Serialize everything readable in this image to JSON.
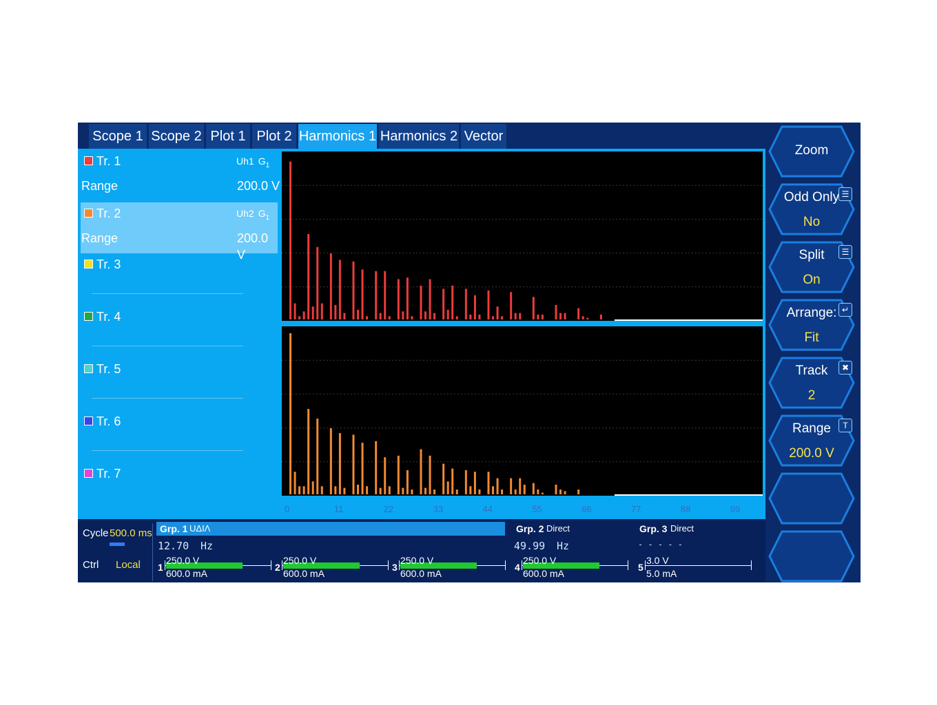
{
  "tabs": [
    "Scope 1",
    "Scope 2",
    "Plot 1",
    "Plot 2",
    "Harmonics 1",
    "Harmonics 2",
    "Vector"
  ],
  "active_tab": "Harmonics 1",
  "tracks": [
    {
      "label": "Tr. 1",
      "color": "#ee3b3b",
      "signal": "Uh1",
      "group": "G",
      "group_sub": "1",
      "range_label": "Range",
      "range_value": "200.0 V"
    },
    {
      "label": "Tr. 2",
      "color": "#f28a33",
      "signal": "Uh2",
      "group": "G",
      "group_sub": "1",
      "range_label": "Range",
      "range_value": "200.0 V"
    },
    {
      "label": "Tr. 3",
      "color": "#f3e21b"
    },
    {
      "label": "Tr. 4",
      "color": "#24a745"
    },
    {
      "label": "Tr. 5",
      "color": "#45d6d2"
    },
    {
      "label": "Tr. 6",
      "color": "#3a45e6"
    },
    {
      "label": "Tr. 7",
      "color": "#e046d6"
    }
  ],
  "softkeys": [
    {
      "label": "Zoom",
      "value": "",
      "icon": ""
    },
    {
      "label": "Odd Only",
      "value": "No",
      "icon": "list-icon"
    },
    {
      "label": "Split",
      "value": "On",
      "icon": "list-icon"
    },
    {
      "label": "Arrange:",
      "value": "Fit",
      "icon": "enter-icon"
    },
    {
      "label": "Track",
      "value": "2",
      "icon": "tools-icon"
    },
    {
      "label": "Range",
      "value": "200.0 V",
      "icon": "range-icon"
    },
    {
      "label": "",
      "value": "",
      "icon": ""
    },
    {
      "label": "",
      "value": "",
      "icon": ""
    }
  ],
  "status": {
    "cycle_label": "Cycle",
    "cycle_value": "500.0 ms",
    "ctrl_label": "Ctrl",
    "ctrl_value": "Local",
    "groups": [
      {
        "name": "Grp. 1",
        "mode": "UΔIΛ",
        "value": "12.70",
        "unit": "Hz"
      },
      {
        "name": "Grp. 2",
        "mode": "Direct",
        "value": "49.99",
        "unit": "Hz"
      },
      {
        "name": "Grp. 3",
        "mode": "Direct",
        "value": "- - - - -",
        "unit": ""
      }
    ],
    "channels": [
      {
        "num": "1",
        "voltage": "250.0 V",
        "current": "600.0 mA",
        "level": 0.85
      },
      {
        "num": "2",
        "voltage": "250.0 V",
        "current": "600.0 mA",
        "level": 0.85
      },
      {
        "num": "3",
        "voltage": "250.0 V",
        "current": "600.0 mA",
        "level": 0.85
      },
      {
        "num": "4",
        "voltage": "250.0 V",
        "current": "600.0 mA",
        "level": 0.85
      },
      {
        "num": "5",
        "voltage": "3.0 V",
        "current": "5.0 mA",
        "level": 0.0
      }
    ]
  },
  "chart_data": [
    {
      "type": "bar",
      "series": [
        {
          "name": "Tr. 1",
          "color": "#ee3b3b"
        }
      ],
      "x_ticks": [],
      "x_range": [
        0,
        105
      ],
      "y_range": [
        0,
        1
      ],
      "grid": true,
      "bars": [
        [
          1,
          0.98
        ],
        [
          2,
          0.1
        ],
        [
          3,
          0.02
        ],
        [
          4,
          0.05
        ],
        [
          5,
          0.53
        ],
        [
          6,
          0.08
        ],
        [
          7,
          0.45
        ],
        [
          8,
          0.1
        ],
        [
          10,
          0.41
        ],
        [
          11,
          0.09
        ],
        [
          12,
          0.37
        ],
        [
          13,
          0.04
        ],
        [
          15,
          0.36
        ],
        [
          16,
          0.06
        ],
        [
          17,
          0.31
        ],
        [
          18,
          0.02
        ],
        [
          20,
          0.3
        ],
        [
          21,
          0.04
        ],
        [
          22,
          0.3
        ],
        [
          23,
          0.02
        ],
        [
          25,
          0.25
        ],
        [
          26,
          0.05
        ],
        [
          27,
          0.26
        ],
        [
          28,
          0.02
        ],
        [
          30,
          0.21
        ],
        [
          31,
          0.05
        ],
        [
          32,
          0.25
        ],
        [
          33,
          0.04
        ],
        [
          35,
          0.19
        ],
        [
          36,
          0.06
        ],
        [
          37,
          0.21
        ],
        [
          38,
          0.02
        ],
        [
          40,
          0.19
        ],
        [
          41,
          0.03
        ],
        [
          42,
          0.15
        ],
        [
          43,
          0.03
        ],
        [
          45,
          0.18
        ],
        [
          46,
          0.02
        ],
        [
          47,
          0.08
        ],
        [
          48,
          0.02
        ],
        [
          50,
          0.17
        ],
        [
          51,
          0.04
        ],
        [
          52,
          0.04
        ],
        [
          55,
          0.14
        ],
        [
          56,
          0.03
        ],
        [
          57,
          0.03
        ],
        [
          60,
          0.09
        ],
        [
          61,
          0.04
        ],
        [
          62,
          0.04
        ],
        [
          65,
          0.07
        ],
        [
          66,
          0.02
        ],
        [
          67,
          0.01
        ],
        [
          70,
          0.03
        ]
      ]
    },
    {
      "type": "bar",
      "series": [
        {
          "name": "Tr. 2",
          "color": "#f28a33"
        }
      ],
      "x_ticks": [
        "0",
        "11",
        "22",
        "33",
        "44",
        "55",
        "66",
        "77",
        "88",
        "99"
      ],
      "x_range": [
        0,
        105
      ],
      "y_range": [
        0,
        1
      ],
      "grid": true,
      "bars": [
        [
          1,
          1.0
        ],
        [
          2,
          0.14
        ],
        [
          3,
          0.05
        ],
        [
          4,
          0.05
        ],
        [
          5,
          0.53
        ],
        [
          6,
          0.08
        ],
        [
          7,
          0.47
        ],
        [
          8,
          0.05
        ],
        [
          10,
          0.41
        ],
        [
          11,
          0.05
        ],
        [
          12,
          0.38
        ],
        [
          13,
          0.04
        ],
        [
          15,
          0.37
        ],
        [
          16,
          0.06
        ],
        [
          17,
          0.32
        ],
        [
          18,
          0.05
        ],
        [
          20,
          0.33
        ],
        [
          21,
          0.04
        ],
        [
          22,
          0.23
        ],
        [
          23,
          0.05
        ],
        [
          25,
          0.24
        ],
        [
          26,
          0.04
        ],
        [
          27,
          0.15
        ],
        [
          28,
          0.03
        ],
        [
          30,
          0.28
        ],
        [
          31,
          0.04
        ],
        [
          32,
          0.24
        ],
        [
          33,
          0.03
        ],
        [
          35,
          0.19
        ],
        [
          36,
          0.08
        ],
        [
          37,
          0.16
        ],
        [
          38,
          0.03
        ],
        [
          40,
          0.15
        ],
        [
          41,
          0.05
        ],
        [
          42,
          0.14
        ],
        [
          43,
          0.03
        ],
        [
          45,
          0.14
        ],
        [
          46,
          0.05
        ],
        [
          47,
          0.1
        ],
        [
          48,
          0.03
        ],
        [
          50,
          0.1
        ],
        [
          51,
          0.03
        ],
        [
          52,
          0.1
        ],
        [
          53,
          0.06
        ],
        [
          55,
          0.07
        ],
        [
          56,
          0.03
        ],
        [
          57,
          0.01
        ],
        [
          60,
          0.06
        ],
        [
          61,
          0.03
        ],
        [
          62,
          0.02
        ],
        [
          65,
          0.03
        ]
      ]
    }
  ]
}
